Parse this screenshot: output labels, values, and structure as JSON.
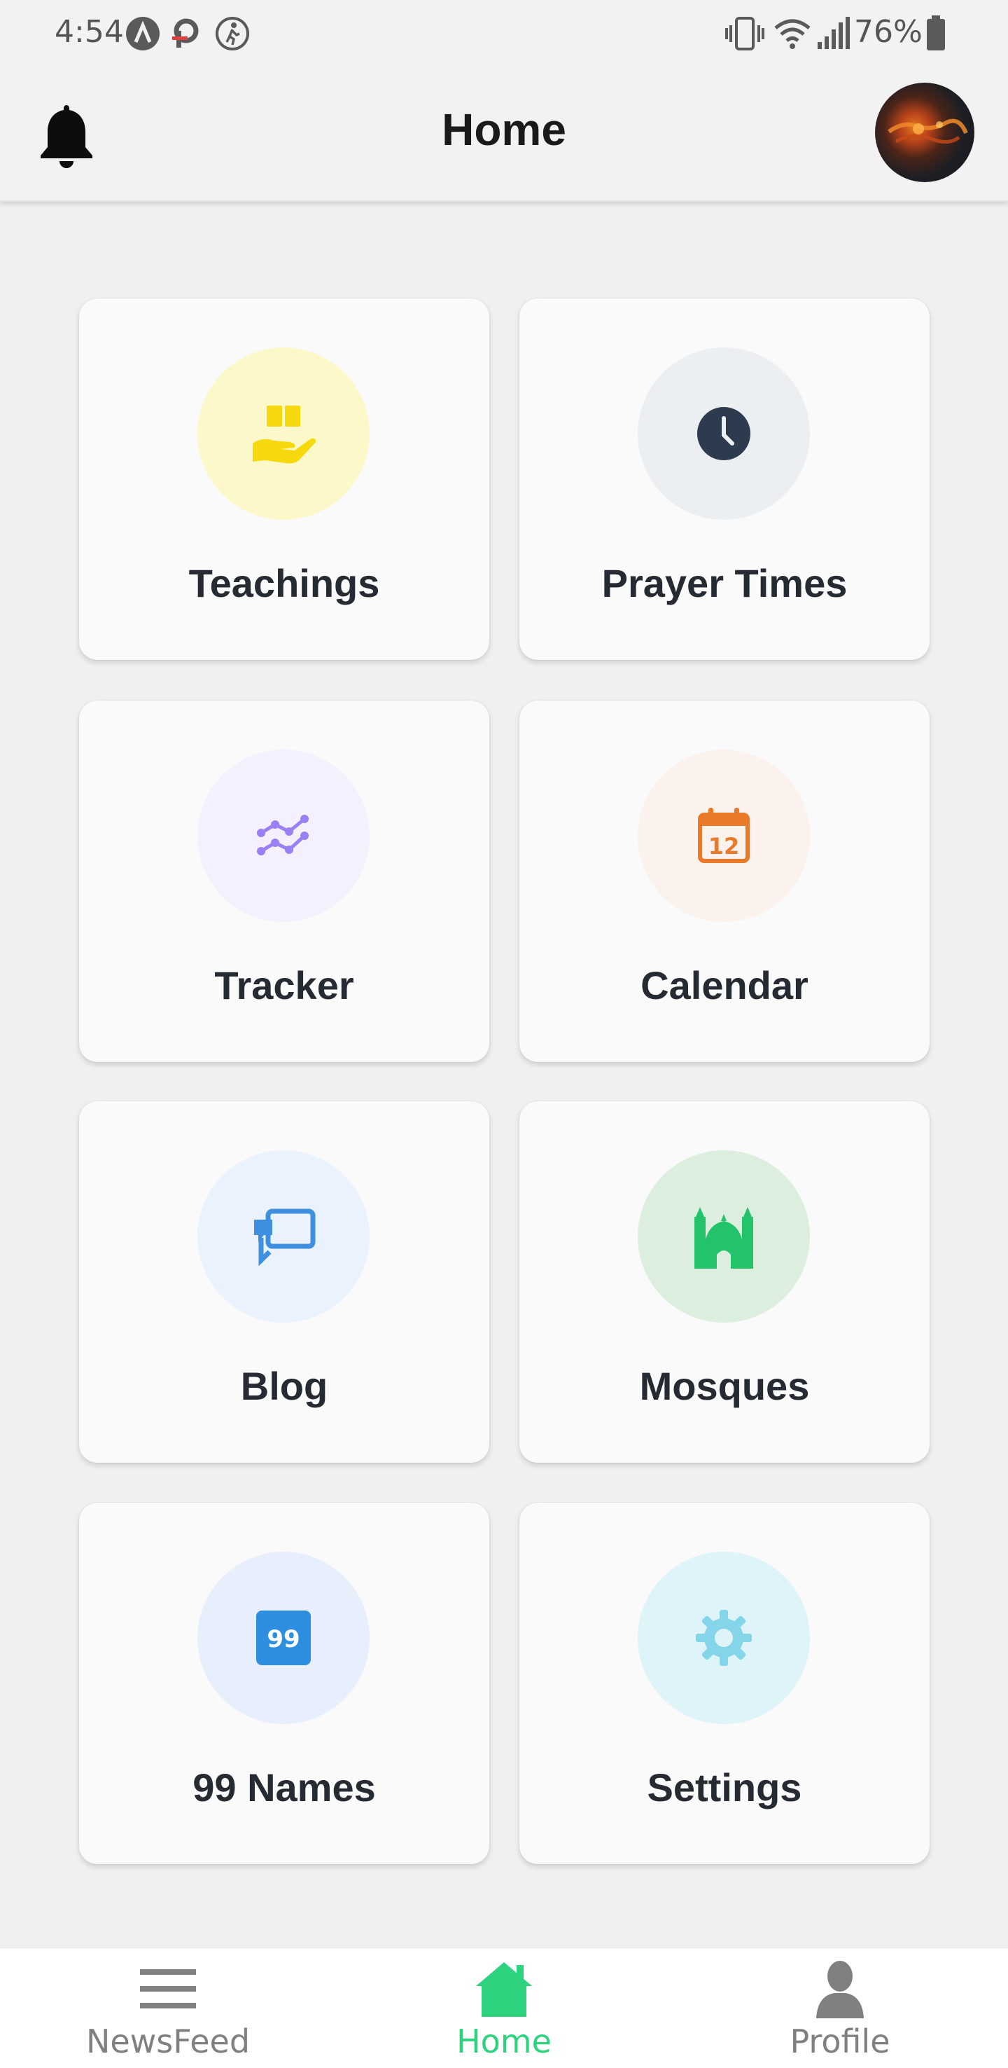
{
  "status_bar": {
    "time": "4:54",
    "battery": "76%"
  },
  "header": {
    "title": "Home",
    "bell_icon": "bell-icon",
    "avatar": "profile-avatar"
  },
  "grid": {
    "items": [
      {
        "label": "Teachings",
        "icon": "book-hand-icon",
        "icon_color": "#f5d90c",
        "bg": "#fdf8c9"
      },
      {
        "label": "Prayer Times",
        "icon": "clock-icon",
        "icon_color": "#2d3b4f",
        "bg": "#eceff2"
      },
      {
        "label": "Tracker",
        "icon": "trend-line-icon",
        "icon_color": "#9b80f5",
        "bg": "#f4f0fd"
      },
      {
        "label": "Calendar",
        "icon": "calendar-icon",
        "icon_color": "#e87a2a",
        "bg": "#fbf2ee",
        "icon_text": "12"
      },
      {
        "label": "Blog",
        "icon": "chat-bubbles-icon",
        "icon_color": "#3f8fe0",
        "bg": "#eaf3fd"
      },
      {
        "label": "Mosques",
        "icon": "mosque-icon",
        "icon_color": "#22c36a",
        "bg": "#dcefdf"
      },
      {
        "label": "99 Names",
        "icon": "badge-99-icon",
        "icon_color": "#2e8fe0",
        "bg": "#e8effc",
        "icon_text": "99"
      },
      {
        "label": "Settings",
        "icon": "gear-icon",
        "icon_color": "#84d4ea",
        "bg": "#def4f8"
      }
    ]
  },
  "bottom_nav": {
    "items": [
      {
        "label": "NewsFeed",
        "icon": "menu-icon",
        "active": false
      },
      {
        "label": "Home",
        "icon": "home-icon",
        "active": true
      },
      {
        "label": "Profile",
        "icon": "person-icon",
        "active": false
      }
    ]
  },
  "colors": {
    "accent": "#2dd37e",
    "inactive": "#808080",
    "background": "#f0f0f0",
    "card": "#fafafa"
  }
}
